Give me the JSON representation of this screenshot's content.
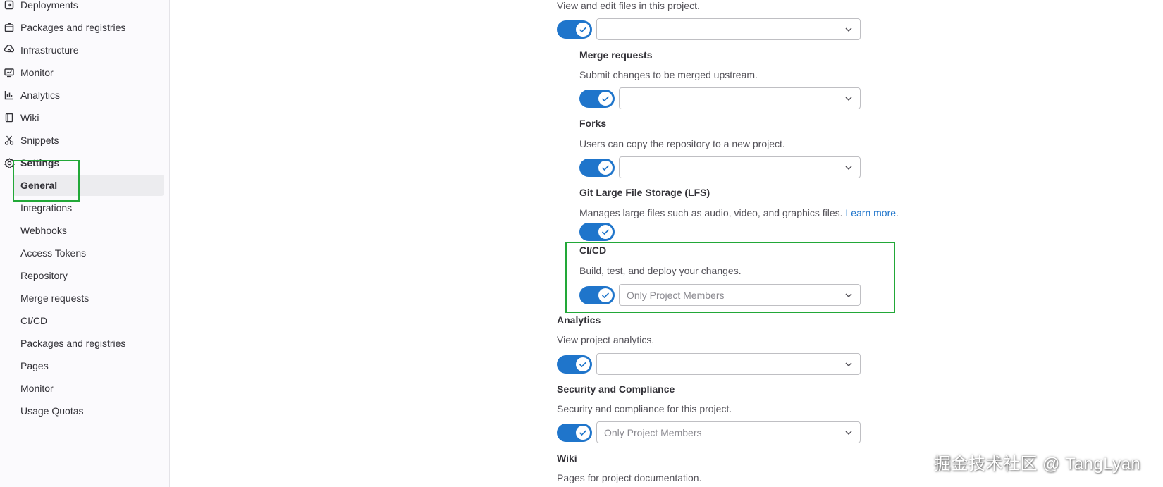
{
  "sidebar": {
    "items": [
      {
        "label": "Deployments",
        "icon": "deployments-icon"
      },
      {
        "label": "Packages and registries",
        "icon": "package-icon"
      },
      {
        "label": "Infrastructure",
        "icon": "infrastructure-icon"
      },
      {
        "label": "Monitor",
        "icon": "monitor-icon"
      },
      {
        "label": "Analytics",
        "icon": "analytics-icon"
      },
      {
        "label": "Wiki",
        "icon": "book-icon"
      },
      {
        "label": "Snippets",
        "icon": "snippet-icon"
      },
      {
        "label": "Settings",
        "icon": "gear-icon"
      }
    ],
    "settings_sub": [
      {
        "label": "General"
      },
      {
        "label": "Integrations"
      },
      {
        "label": "Webhooks"
      },
      {
        "label": "Access Tokens"
      },
      {
        "label": "Repository"
      },
      {
        "label": "Merge requests"
      },
      {
        "label": "CI/CD"
      },
      {
        "label": "Packages and registries"
      },
      {
        "label": "Pages"
      },
      {
        "label": "Monitor"
      },
      {
        "label": "Usage Quotas"
      }
    ]
  },
  "settings": {
    "repository_desc": "View and edit files in this project.",
    "merge_requests": {
      "title": "Merge requests",
      "desc": "Submit changes to be merged upstream."
    },
    "forks": {
      "title": "Forks",
      "desc": "Users can copy the repository to a new project."
    },
    "lfs": {
      "title": "Git Large File Storage (LFS)",
      "desc": "Manages large files such as audio, video, and graphics files.",
      "link": "Learn more"
    },
    "lfs_period": ".",
    "cicd": {
      "title": "CI/CD",
      "desc": "Build, test, and deploy your changes.",
      "select": "Only Project Members"
    },
    "analytics": {
      "title": "Analytics",
      "desc": "View project analytics."
    },
    "security": {
      "title": "Security and Compliance",
      "desc": "Security and compliance for this project.",
      "select": "Only Project Members"
    },
    "wiki": {
      "title": "Wiki",
      "desc": "Pages for project documentation."
    }
  },
  "watermark": "掘金技术社区 @ TangLyan",
  "colors": {
    "accent": "#1f75cb",
    "highlight": "#22a838",
    "link": "#1f75cb"
  }
}
